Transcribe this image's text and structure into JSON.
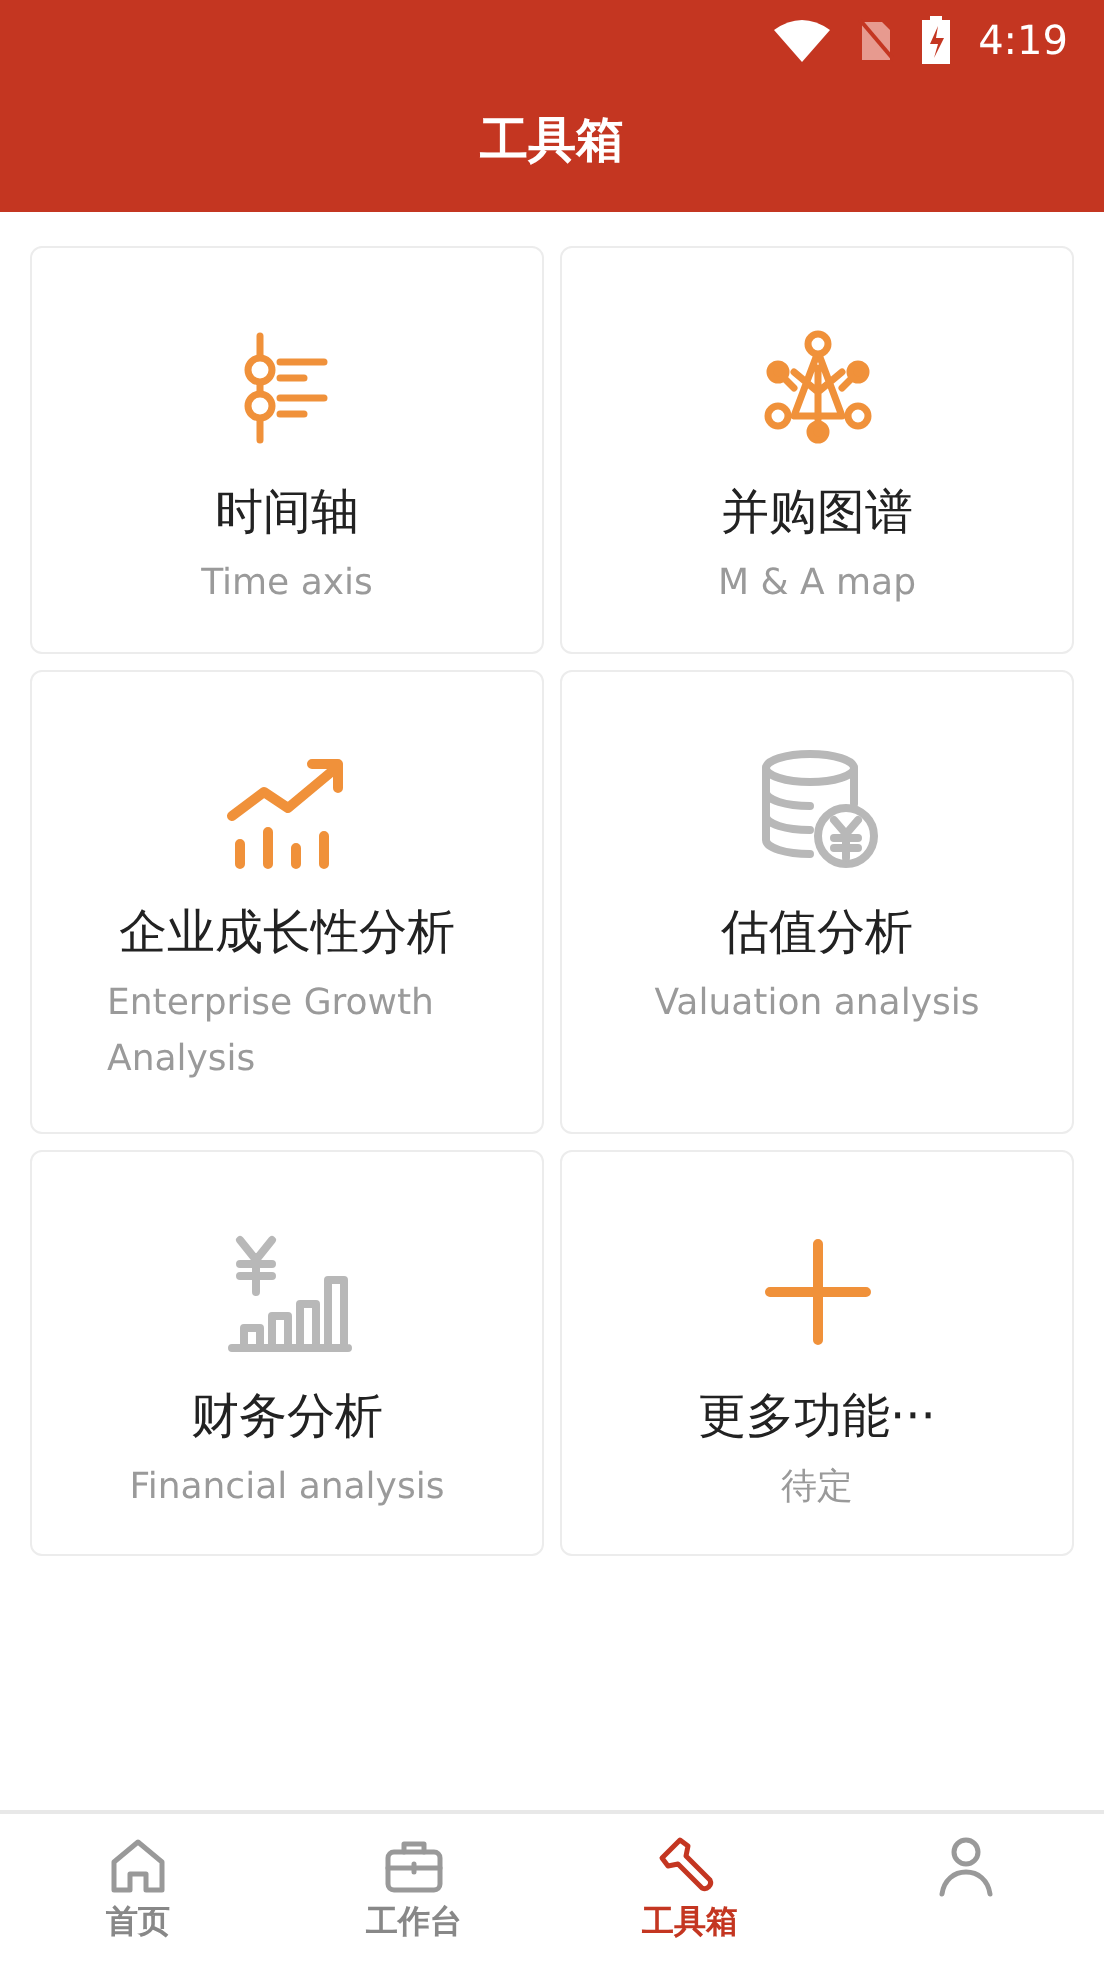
{
  "status_bar": {
    "time": "4:19"
  },
  "header": {
    "title": "工具箱"
  },
  "tools": [
    {
      "kind": "timeline",
      "title": "时间轴",
      "subtitle": "Time axis"
    },
    {
      "kind": "network",
      "title": "并购图谱",
      "subtitle": "M & A map"
    },
    {
      "kind": "growth",
      "title": "企业成长性分析",
      "subtitle": "Enterprise Growth Analysis"
    },
    {
      "kind": "valuation",
      "title": "估值分析",
      "subtitle": "Valuation analysis"
    },
    {
      "kind": "finance",
      "title": "财务分析",
      "subtitle": "Financial analysis"
    },
    {
      "kind": "more",
      "title": "更多功能···",
      "subtitle": "待定"
    }
  ],
  "tabs": [
    {
      "kind": "home",
      "label": "首页",
      "selected": false
    },
    {
      "kind": "work",
      "label": "工作台",
      "selected": false
    },
    {
      "kind": "tools",
      "label": "工具箱",
      "selected": true
    },
    {
      "kind": "person",
      "selected": false
    }
  ]
}
